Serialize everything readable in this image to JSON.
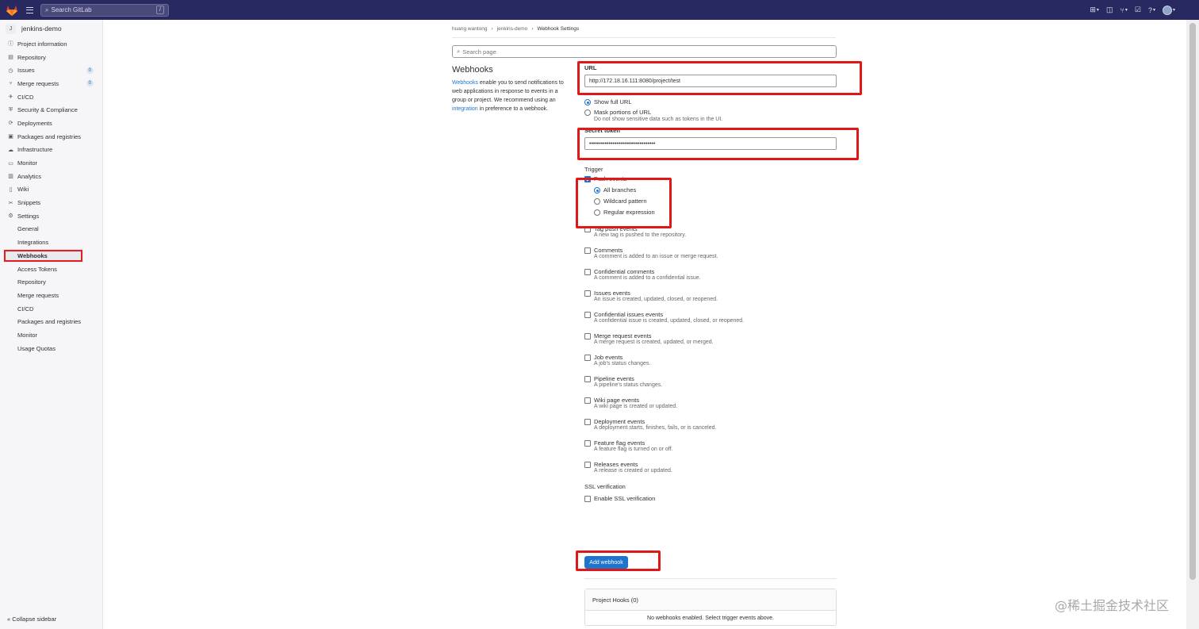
{
  "topbar": {
    "search_placeholder": "Search GitLab",
    "search_shortcut": "/"
  },
  "sidebar": {
    "project_initial": "J",
    "project_name": "jenkins-demo",
    "items": [
      {
        "label": "Project information",
        "icon": "info-icon"
      },
      {
        "label": "Repository",
        "icon": "doc-icon"
      },
      {
        "label": "Issues",
        "icon": "issues-icon",
        "badge": "0"
      },
      {
        "label": "Merge requests",
        "icon": "merge-icon",
        "badge": "0"
      },
      {
        "label": "CI/CD",
        "icon": "rocket-icon"
      },
      {
        "label": "Security & Compliance",
        "icon": "shield-icon"
      },
      {
        "label": "Deployments",
        "icon": "deploy-icon"
      },
      {
        "label": "Packages and registries",
        "icon": "package-icon"
      },
      {
        "label": "Infrastructure",
        "icon": "cloud-icon"
      },
      {
        "label": "Monitor",
        "icon": "monitor-icon"
      },
      {
        "label": "Analytics",
        "icon": "chart-icon"
      },
      {
        "label": "Wiki",
        "icon": "book-icon"
      },
      {
        "label": "Snippets",
        "icon": "scissors-icon"
      },
      {
        "label": "Settings",
        "icon": "gear-icon"
      }
    ],
    "settings_sub": [
      "General",
      "Integrations",
      "Webhooks",
      "Access Tokens",
      "Repository",
      "Merge requests",
      "CI/CD",
      "Packages and registries",
      "Monitor",
      "Usage Quotas"
    ],
    "collapse": "Collapse sidebar"
  },
  "breadcrumb": [
    "huang wantong",
    "jenkins-demo",
    "Webhook Settings"
  ],
  "page_search_placeholder": "Search page",
  "intro": {
    "title": "Webhooks",
    "link1": "Webhooks",
    "text1": " enable you to send notifications to web applications in response to events in a group or project. We recommend using an ",
    "link2": "integration",
    "text2": " in preference to a webhook."
  },
  "form": {
    "url_label": "URL",
    "url_value": "http://172.18.16.111:8080/project/test",
    "show_full_url": "Show full URL",
    "mask_url": "Mask portions of URL",
    "mask_help": "Do not show sensitive data such as tokens in the UI.",
    "secret_label": "Secret token",
    "secret_value": "••••••••••••••••••••••••••••••••••",
    "trigger_label": "Trigger",
    "push_events": "Push events",
    "branch_options": [
      "All branches",
      "Wildcard pattern",
      "Regular expression"
    ],
    "events": [
      {
        "label": "Tag push events",
        "desc": "A new tag is pushed to the repository."
      },
      {
        "label": "Comments",
        "desc": "A comment is added to an issue or merge request."
      },
      {
        "label": "Confidential comments",
        "desc": "A comment is added to a confidential issue."
      },
      {
        "label": "Issues events",
        "desc": "An issue is created, updated, closed, or reopened."
      },
      {
        "label": "Confidential issues events",
        "desc": "A confidential issue is created, updated, closed, or reopened."
      },
      {
        "label": "Merge request events",
        "desc": "A merge request is created, updated, or merged."
      },
      {
        "label": "Job events",
        "desc": "A job's status changes."
      },
      {
        "label": "Pipeline events",
        "desc": "A pipeline's status changes."
      },
      {
        "label": "Wiki page events",
        "desc": "A wiki page is created or updated."
      },
      {
        "label": "Deployment events",
        "desc": "A deployment starts, finishes, fails, or is canceled."
      },
      {
        "label": "Feature flag events",
        "desc": "A feature flag is turned on or off."
      },
      {
        "label": "Releases events",
        "desc": "A release is created or updated."
      }
    ],
    "ssl_label": "SSL verification",
    "ssl_check": "Enable SSL verification",
    "add_button": "Add webhook"
  },
  "hooks": {
    "header": "Project Hooks (0)",
    "empty": "No webhooks enabled. Select trigger events above."
  },
  "watermark": "@稀土掘金技术社区",
  "colors": {
    "navbar": "#292961",
    "accent": "#1f75cb",
    "highlight": "#e01818"
  }
}
